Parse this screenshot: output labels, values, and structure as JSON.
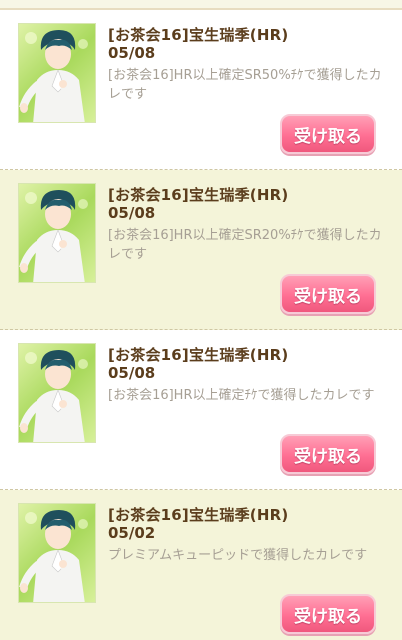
{
  "colors": {
    "title_brown": "#5b3d1c",
    "desc_gray": "#a69f94",
    "button_pink": "#ff6f93",
    "thumb_green": "#a9d95c",
    "row_cream": "#f4f4d9"
  },
  "gift_list": {
    "items": [
      {
        "title": "[お茶会16]宝生瑞季(HR)",
        "date": "05/08",
        "description": "[お茶会16]HR以上確定SR50%ﾁｹで獲得したカレです",
        "button_label": "受け取る",
        "thumbnail_icon": "character-portrait-icon"
      },
      {
        "title": "[お茶会16]宝生瑞季(HR)",
        "date": "05/08",
        "description": "[お茶会16]HR以上確定SR20%ﾁｹで獲得したカレです",
        "button_label": "受け取る",
        "thumbnail_icon": "character-portrait-icon"
      },
      {
        "title": "[お茶会16]宝生瑞季(HR)",
        "date": "05/08",
        "description": "[お茶会16]HR以上確定ﾁｹで獲得したカレです",
        "button_label": "受け取る",
        "thumbnail_icon": "character-portrait-icon"
      },
      {
        "title": "[お茶会16]宝生瑞季(HR)",
        "date": "05/02",
        "description": "プレミアムキューピッドで獲得したカレです",
        "button_label": "受け取る",
        "thumbnail_icon": "character-portrait-icon"
      }
    ]
  }
}
